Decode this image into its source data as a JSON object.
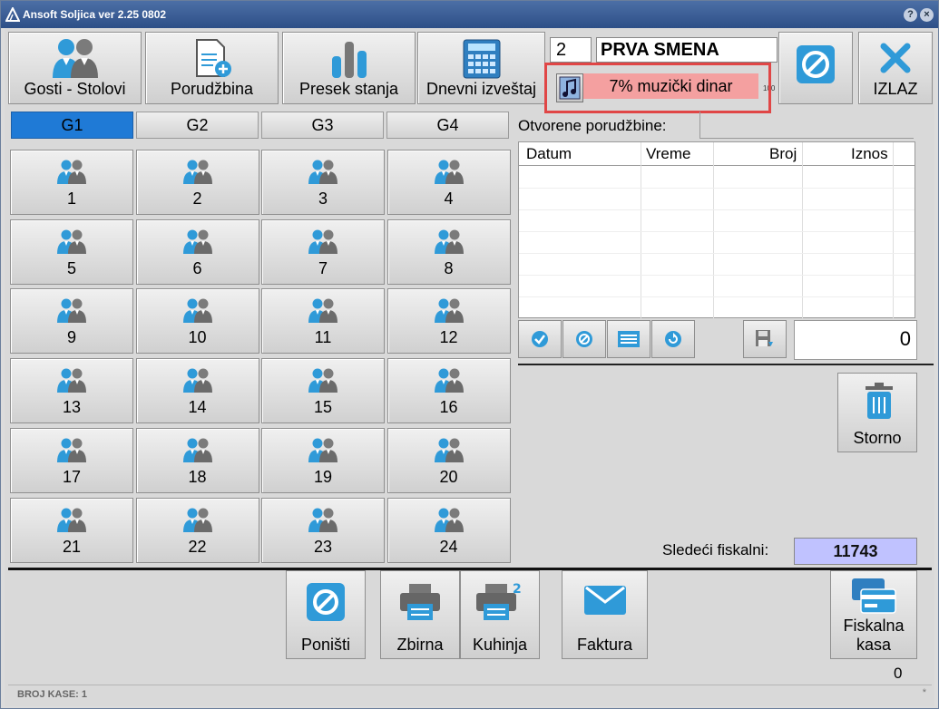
{
  "window": {
    "title": "Ansoft Soljica ver 2.25 0802",
    "help": "?",
    "close": "×"
  },
  "toolbar": {
    "guests_tables": "Gosti - Stolovi",
    "order": "Porudžbina",
    "status_cut": "Presek stanja",
    "daily_report": "Dnevni izveštaj",
    "exit": "IZLAZ"
  },
  "shift": {
    "number": "2",
    "name": "PRVA SMENA"
  },
  "music": {
    "label": "7% muzički dinar",
    "tiny": "100"
  },
  "groups": [
    "G1",
    "G2",
    "G3",
    "G4"
  ],
  "active_group": "G1",
  "tables": [
    "1",
    "2",
    "3",
    "4",
    "5",
    "6",
    "7",
    "8",
    "9",
    "10",
    "11",
    "12",
    "13",
    "14",
    "15",
    "16",
    "17",
    "18",
    "19",
    "20",
    "21",
    "22",
    "23",
    "24"
  ],
  "orders": {
    "label": "Otvorene porudžbine:",
    "columns": [
      "Datum",
      "Vreme",
      "Broj",
      "Iznos"
    ],
    "rows": [],
    "count": "0"
  },
  "storno": "Storno",
  "fiscal": {
    "label": "Sledeći fiskalni:",
    "value": "11743"
  },
  "bottom": {
    "cancel": "Poništi",
    "summary": "Zbirna",
    "kitchen": "Kuhinja",
    "invoice": "Faktura",
    "fiscal_register_1": "Fiskalna",
    "fiscal_register_2": "kasa",
    "counter": "0"
  },
  "status": {
    "register": "BROJ KASE: 1",
    "indicator": "*"
  },
  "colors": {
    "accent": "#1f7ad6",
    "music_bg": "#f4a0a0",
    "fiscal_bg": "#c0c2ff",
    "icon_blue": "#2f9ad8"
  }
}
